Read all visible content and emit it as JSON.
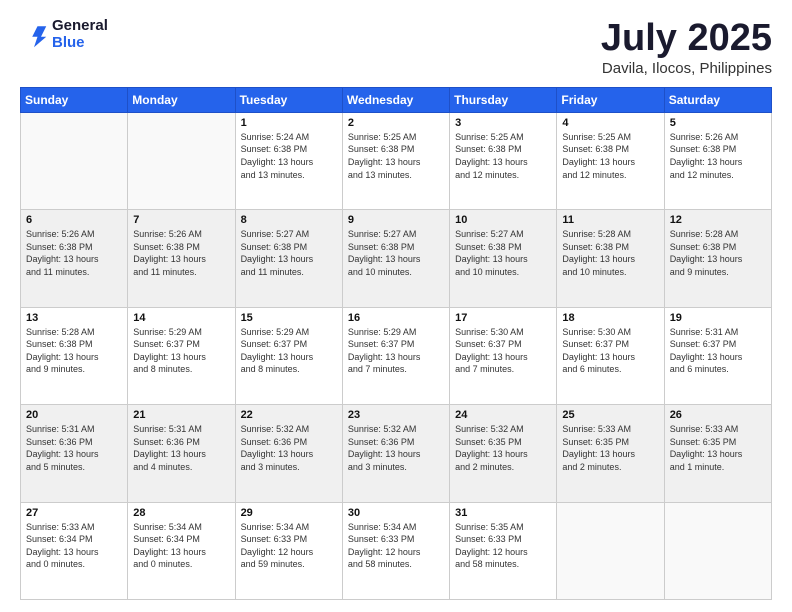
{
  "header": {
    "logo_general": "General",
    "logo_blue": "Blue",
    "title": "July 2025",
    "location": "Davila, Ilocos, Philippines"
  },
  "calendar": {
    "days_of_week": [
      "Sunday",
      "Monday",
      "Tuesday",
      "Wednesday",
      "Thursday",
      "Friday",
      "Saturday"
    ],
    "weeks": [
      [
        {
          "num": "",
          "detail": ""
        },
        {
          "num": "",
          "detail": ""
        },
        {
          "num": "1",
          "detail": "Sunrise: 5:24 AM\nSunset: 6:38 PM\nDaylight: 13 hours\nand 13 minutes."
        },
        {
          "num": "2",
          "detail": "Sunrise: 5:25 AM\nSunset: 6:38 PM\nDaylight: 13 hours\nand 13 minutes."
        },
        {
          "num": "3",
          "detail": "Sunrise: 5:25 AM\nSunset: 6:38 PM\nDaylight: 13 hours\nand 12 minutes."
        },
        {
          "num": "4",
          "detail": "Sunrise: 5:25 AM\nSunset: 6:38 PM\nDaylight: 13 hours\nand 12 minutes."
        },
        {
          "num": "5",
          "detail": "Sunrise: 5:26 AM\nSunset: 6:38 PM\nDaylight: 13 hours\nand 12 minutes."
        }
      ],
      [
        {
          "num": "6",
          "detail": "Sunrise: 5:26 AM\nSunset: 6:38 PM\nDaylight: 13 hours\nand 11 minutes."
        },
        {
          "num": "7",
          "detail": "Sunrise: 5:26 AM\nSunset: 6:38 PM\nDaylight: 13 hours\nand 11 minutes."
        },
        {
          "num": "8",
          "detail": "Sunrise: 5:27 AM\nSunset: 6:38 PM\nDaylight: 13 hours\nand 11 minutes."
        },
        {
          "num": "9",
          "detail": "Sunrise: 5:27 AM\nSunset: 6:38 PM\nDaylight: 13 hours\nand 10 minutes."
        },
        {
          "num": "10",
          "detail": "Sunrise: 5:27 AM\nSunset: 6:38 PM\nDaylight: 13 hours\nand 10 minutes."
        },
        {
          "num": "11",
          "detail": "Sunrise: 5:28 AM\nSunset: 6:38 PM\nDaylight: 13 hours\nand 10 minutes."
        },
        {
          "num": "12",
          "detail": "Sunrise: 5:28 AM\nSunset: 6:38 PM\nDaylight: 13 hours\nand 9 minutes."
        }
      ],
      [
        {
          "num": "13",
          "detail": "Sunrise: 5:28 AM\nSunset: 6:38 PM\nDaylight: 13 hours\nand 9 minutes."
        },
        {
          "num": "14",
          "detail": "Sunrise: 5:29 AM\nSunset: 6:37 PM\nDaylight: 13 hours\nand 8 minutes."
        },
        {
          "num": "15",
          "detail": "Sunrise: 5:29 AM\nSunset: 6:37 PM\nDaylight: 13 hours\nand 8 minutes."
        },
        {
          "num": "16",
          "detail": "Sunrise: 5:29 AM\nSunset: 6:37 PM\nDaylight: 13 hours\nand 7 minutes."
        },
        {
          "num": "17",
          "detail": "Sunrise: 5:30 AM\nSunset: 6:37 PM\nDaylight: 13 hours\nand 7 minutes."
        },
        {
          "num": "18",
          "detail": "Sunrise: 5:30 AM\nSunset: 6:37 PM\nDaylight: 13 hours\nand 6 minutes."
        },
        {
          "num": "19",
          "detail": "Sunrise: 5:31 AM\nSunset: 6:37 PM\nDaylight: 13 hours\nand 6 minutes."
        }
      ],
      [
        {
          "num": "20",
          "detail": "Sunrise: 5:31 AM\nSunset: 6:36 PM\nDaylight: 13 hours\nand 5 minutes."
        },
        {
          "num": "21",
          "detail": "Sunrise: 5:31 AM\nSunset: 6:36 PM\nDaylight: 13 hours\nand 4 minutes."
        },
        {
          "num": "22",
          "detail": "Sunrise: 5:32 AM\nSunset: 6:36 PM\nDaylight: 13 hours\nand 3 minutes."
        },
        {
          "num": "23",
          "detail": "Sunrise: 5:32 AM\nSunset: 6:36 PM\nDaylight: 13 hours\nand 3 minutes."
        },
        {
          "num": "24",
          "detail": "Sunrise: 5:32 AM\nSunset: 6:35 PM\nDaylight: 13 hours\nand 2 minutes."
        },
        {
          "num": "25",
          "detail": "Sunrise: 5:33 AM\nSunset: 6:35 PM\nDaylight: 13 hours\nand 2 minutes."
        },
        {
          "num": "26",
          "detail": "Sunrise: 5:33 AM\nSunset: 6:35 PM\nDaylight: 13 hours\nand 1 minute."
        }
      ],
      [
        {
          "num": "27",
          "detail": "Sunrise: 5:33 AM\nSunset: 6:34 PM\nDaylight: 13 hours\nand 0 minutes."
        },
        {
          "num": "28",
          "detail": "Sunrise: 5:34 AM\nSunset: 6:34 PM\nDaylight: 13 hours\nand 0 minutes."
        },
        {
          "num": "29",
          "detail": "Sunrise: 5:34 AM\nSunset: 6:33 PM\nDaylight: 12 hours\nand 59 minutes."
        },
        {
          "num": "30",
          "detail": "Sunrise: 5:34 AM\nSunset: 6:33 PM\nDaylight: 12 hours\nand 58 minutes."
        },
        {
          "num": "31",
          "detail": "Sunrise: 5:35 AM\nSunset: 6:33 PM\nDaylight: 12 hours\nand 58 minutes."
        },
        {
          "num": "",
          "detail": ""
        },
        {
          "num": "",
          "detail": ""
        }
      ]
    ]
  }
}
